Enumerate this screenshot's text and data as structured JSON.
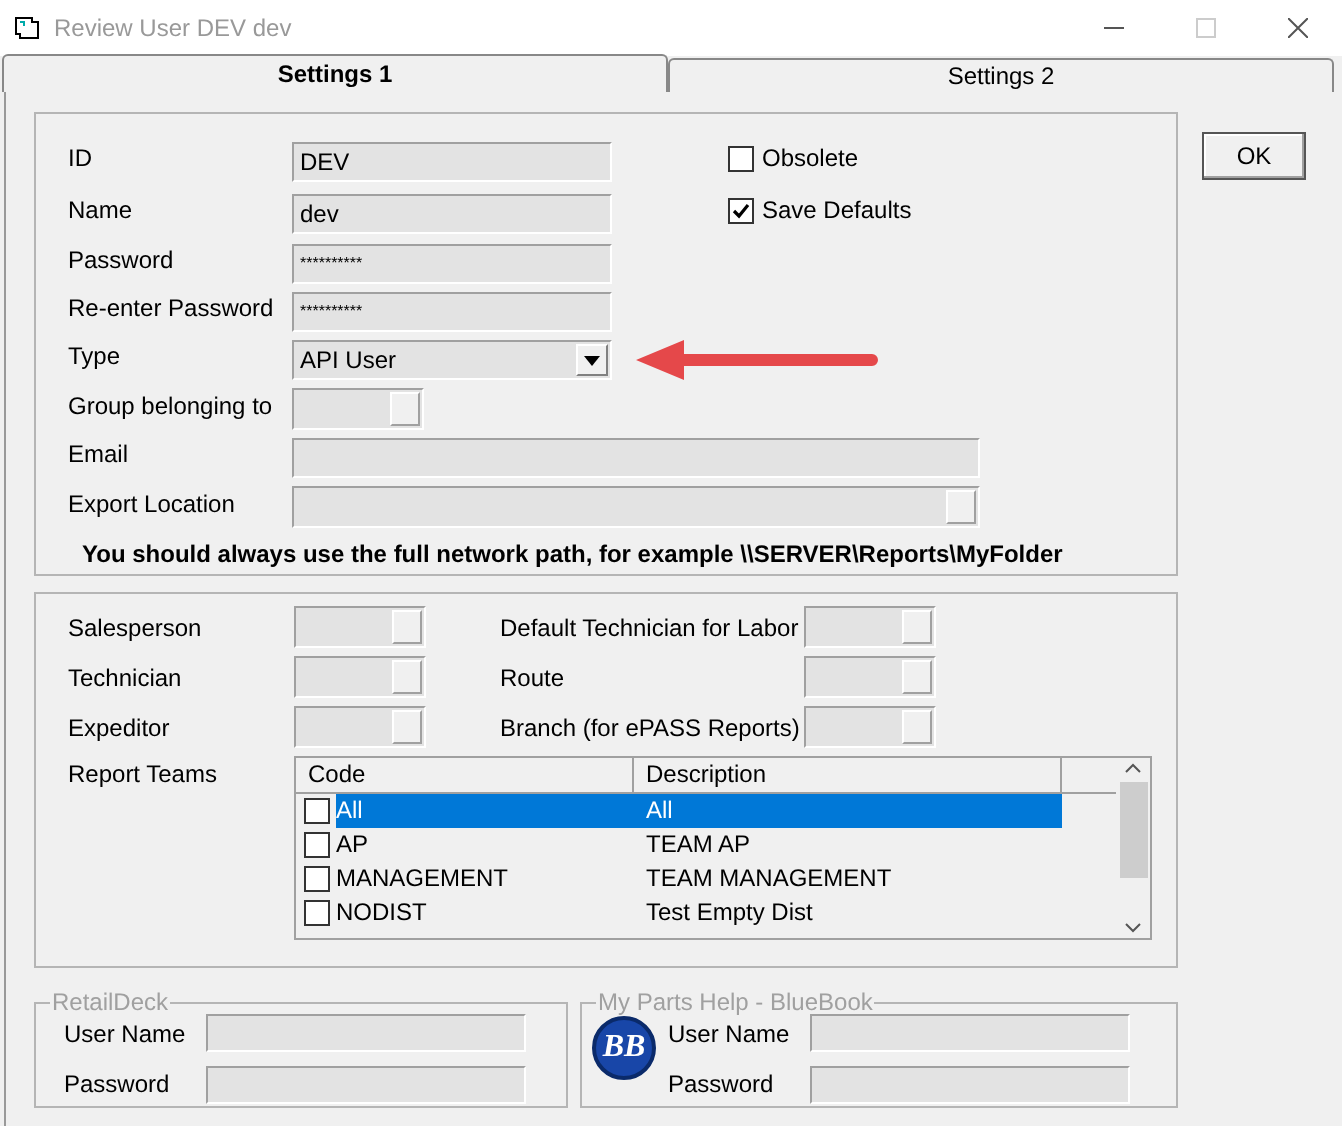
{
  "window": {
    "title": "Review User DEV dev"
  },
  "tabs": [
    {
      "label": "Settings 1",
      "selected": true
    },
    {
      "label": "Settings 2",
      "selected": false
    }
  ],
  "user_fields": [
    {
      "label": "ID",
      "kind": "text",
      "value": "DEV"
    },
    {
      "label": "Name",
      "kind": "text",
      "value": "dev"
    },
    {
      "label": "Password",
      "kind": "password",
      "value": "**********"
    },
    {
      "label": "Re-enter Password",
      "kind": "password",
      "value": "**********"
    },
    {
      "label": "Type",
      "kind": "dropdown",
      "value": "API User"
    },
    {
      "label": "Group belonging to",
      "kind": "lookup"
    },
    {
      "label": "Email",
      "kind": "wide"
    },
    {
      "label": "Export Location",
      "kind": "wide_lookup"
    }
  ],
  "checkboxes": [
    {
      "label": "Obsolete",
      "checked": false
    },
    {
      "label": "Save Defaults",
      "checked": true
    }
  ],
  "path_note": "You should always use the full network path, for example \\\\SERVER\\Reports\\MyFolder",
  "ok_button": "OK",
  "assignments_left": [
    {
      "label": "Salesperson"
    },
    {
      "label": "Technician"
    },
    {
      "label": "Expeditor"
    }
  ],
  "assignments_right": [
    {
      "label": "Default Technician for Labor"
    },
    {
      "label": "Route"
    },
    {
      "label": "Branch (for ePASS Reports)"
    }
  ],
  "report_teams": {
    "label": "Report Teams",
    "columns": [
      "Code",
      "Description"
    ],
    "rows": [
      {
        "code": "All",
        "description": "All",
        "checked": false,
        "selected": true
      },
      {
        "code": "AP",
        "description": "TEAM AP",
        "checked": false,
        "selected": false
      },
      {
        "code": "MANAGEMENT",
        "description": "TEAM MANAGEMENT",
        "checked": false,
        "selected": false
      },
      {
        "code": "NODIST",
        "description": "Test Empty Dist",
        "checked": false,
        "selected": false
      }
    ]
  },
  "retaildeck": {
    "title": "RetailDeck",
    "fields": [
      {
        "label": "User Name"
      },
      {
        "label": "Password"
      }
    ]
  },
  "bluebook": {
    "title": "My Parts Help - BlueBook",
    "logo_text": "BB",
    "fields": [
      {
        "label": "User Name"
      },
      {
        "label": "Password"
      }
    ]
  }
}
